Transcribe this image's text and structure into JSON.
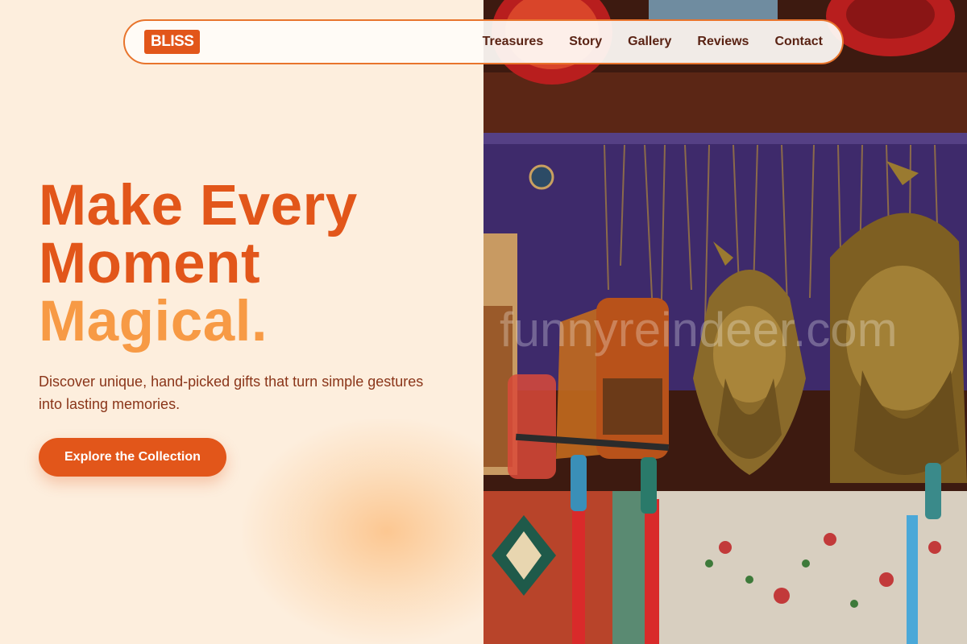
{
  "brand": {
    "logo": "BLISS"
  },
  "nav": {
    "links": [
      "Treasures",
      "Story",
      "Gallery",
      "Reviews",
      "Contact"
    ]
  },
  "hero": {
    "line1": "Make Every",
    "line2": "Moment",
    "line3": "Magical.",
    "subtitle": "Discover unique, hand-picked gifts that turn simple gestures into lasting memories.",
    "cta": "Explore the Collection"
  },
  "image": {
    "watermark": "funnyreindeer.com"
  },
  "colors": {
    "accent": "#e2561a",
    "accent_light": "#f79a45",
    "background": "#fdeedd",
    "text_dark": "#5a2314"
  }
}
